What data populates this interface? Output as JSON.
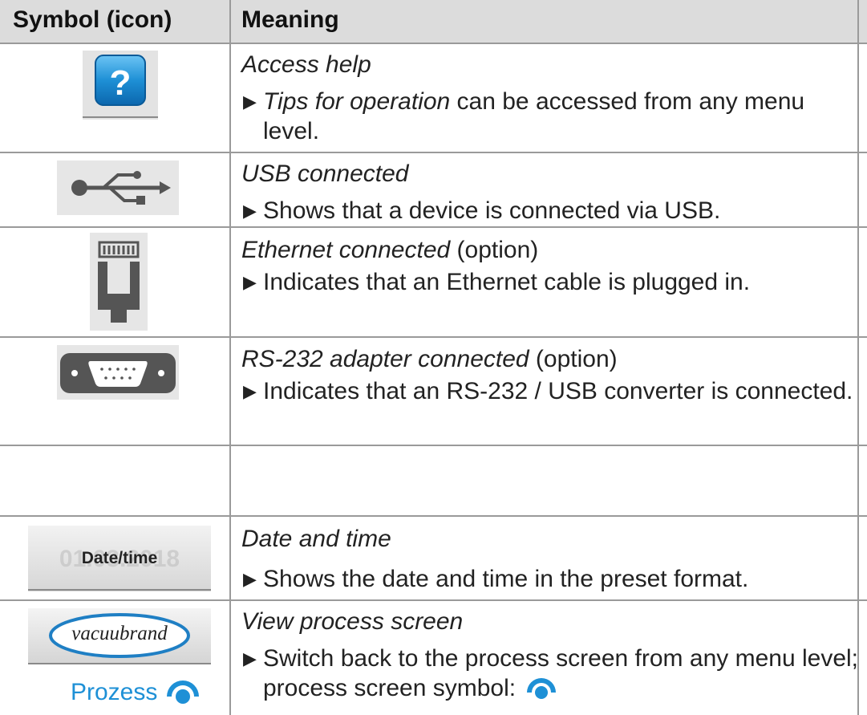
{
  "table": {
    "headers": {
      "symbol": "Symbol (icon)",
      "meaning": "Meaning"
    },
    "rows": [
      {
        "icon": "help-question-icon",
        "title": "Access help",
        "desc_italic": "Tips for operation",
        "desc": " can be accessed from any menu level."
      },
      {
        "icon": "usb-icon",
        "title": "USB connected",
        "desc": "Shows that a device is connected via USB."
      },
      {
        "icon": "ethernet-port-icon",
        "title": "Ethernet connected",
        "title_suffix": " (option)",
        "desc": "Indicates that an Ethernet cable is plugged in."
      },
      {
        "icon": "rs232-port-icon",
        "title": "RS-232 adapter connected",
        "title_suffix": " (option)",
        "desc": "Indicates that an RS-232 / USB converter is connected."
      },
      {
        "icon": "",
        "title": "",
        "desc": ""
      },
      {
        "icon": "date-time-button-icon",
        "icon_label": "Date/time",
        "title": "Date and time",
        "desc": "Shows the date and time in the preset format."
      },
      {
        "icon": "vacuubrand-logo-icon",
        "logo_text": "vacuubrand",
        "icon_label": "Prozess",
        "title": "View process screen",
        "desc": "Switch back to the process screen from any menu level; process screen symbol:"
      }
    ]
  },
  "colors": {
    "header_bg": "#dcdcdc",
    "grid": "#9a9a9a",
    "accent_blue": "#1e90d6"
  }
}
